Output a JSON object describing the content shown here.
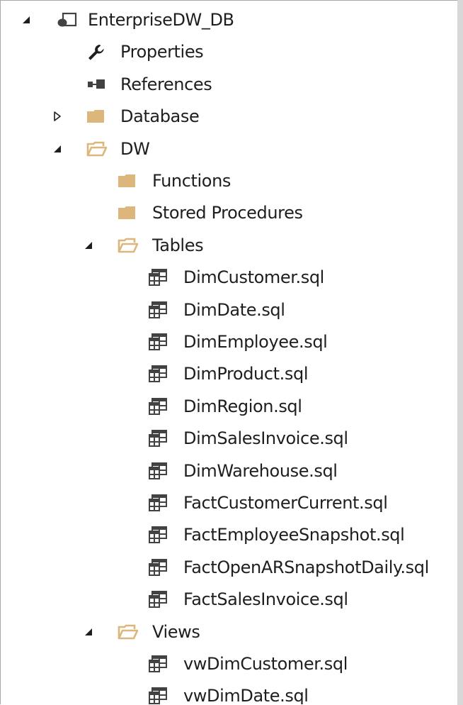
{
  "tree": {
    "nodes": [
      {
        "label": "EnterpriseDW_DB",
        "icon": "database-project-icon",
        "toggle": "expanded",
        "depth": 0
      },
      {
        "label": "Properties",
        "icon": "wrench-icon",
        "toggle": "none",
        "depth": 1
      },
      {
        "label": "References",
        "icon": "references-icon",
        "toggle": "none",
        "depth": 1
      },
      {
        "label": "Database",
        "icon": "folder-icon",
        "toggle": "collapsed",
        "depth": 1
      },
      {
        "label": "DW",
        "icon": "folder-open-icon",
        "toggle": "expanded",
        "depth": 1
      },
      {
        "label": "Functions",
        "icon": "folder-icon",
        "toggle": "none",
        "depth": 2
      },
      {
        "label": "Stored Procedures",
        "icon": "folder-icon",
        "toggle": "none",
        "depth": 2
      },
      {
        "label": "Tables",
        "icon": "folder-open-icon",
        "toggle": "expanded",
        "depth": 2
      },
      {
        "label": "DimCustomer.sql",
        "icon": "sql-table-file-icon",
        "toggle": "none",
        "depth": 3
      },
      {
        "label": "DimDate.sql",
        "icon": "sql-table-file-icon",
        "toggle": "none",
        "depth": 3
      },
      {
        "label": "DimEmployee.sql",
        "icon": "sql-table-file-icon",
        "toggle": "none",
        "depth": 3
      },
      {
        "label": "DimProduct.sql",
        "icon": "sql-table-file-icon",
        "toggle": "none",
        "depth": 3
      },
      {
        "label": "DimRegion.sql",
        "icon": "sql-table-file-icon",
        "toggle": "none",
        "depth": 3
      },
      {
        "label": "DimSalesInvoice.sql",
        "icon": "sql-table-file-icon",
        "toggle": "none",
        "depth": 3
      },
      {
        "label": "DimWarehouse.sql",
        "icon": "sql-table-file-icon",
        "toggle": "none",
        "depth": 3
      },
      {
        "label": "FactCustomerCurrent.sql",
        "icon": "sql-table-file-icon",
        "toggle": "none",
        "depth": 3
      },
      {
        "label": "FactEmployeeSnapshot.sql",
        "icon": "sql-table-file-icon",
        "toggle": "none",
        "depth": 3
      },
      {
        "label": "FactOpenARSnapshotDaily.sql",
        "icon": "sql-table-file-icon",
        "toggle": "none",
        "depth": 3
      },
      {
        "label": "FactSalesInvoice.sql",
        "icon": "sql-table-file-icon",
        "toggle": "none",
        "depth": 3
      },
      {
        "label": "Views",
        "icon": "folder-open-icon",
        "toggle": "expanded",
        "depth": 2
      },
      {
        "label": "vwDimCustomer.sql",
        "icon": "sql-table-file-icon",
        "toggle": "none",
        "depth": 3
      },
      {
        "label": "vwDimDate.sql",
        "icon": "sql-table-file-icon",
        "toggle": "none",
        "depth": 3
      }
    ]
  },
  "colors": {
    "folder": "#dcb67a",
    "folder_dark": "#c49a5a",
    "icon_dark": "#424242",
    "text": "#1e1e1e"
  }
}
